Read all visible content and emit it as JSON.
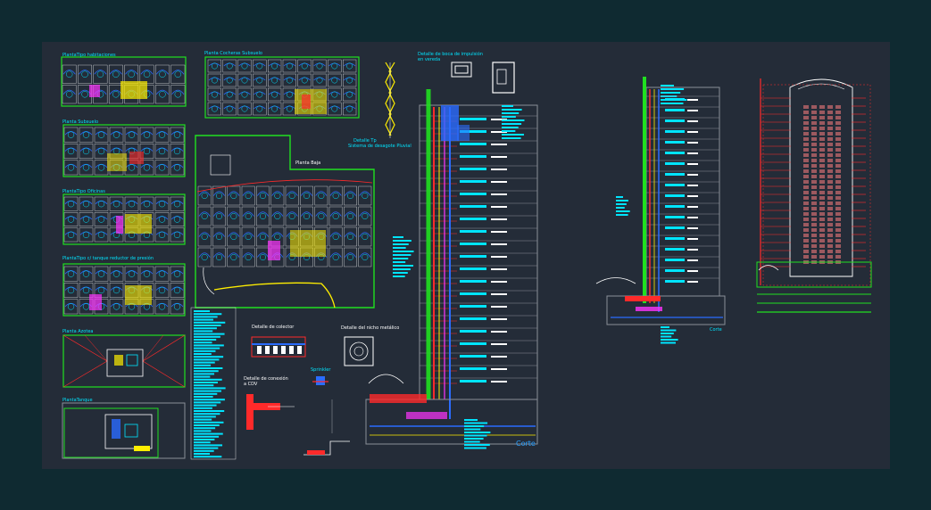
{
  "drawing": {
    "background": "#0f2a31",
    "sheet_color": "#242c38",
    "colors": {
      "green": "#20e020",
      "cyan": "#00e5ff",
      "blue": "#2a6cff",
      "red": "#ff2a2a",
      "magenta": "#ff33ff",
      "yellow": "#ffee00",
      "white": "#ffffff",
      "gray": "#8a8f98"
    }
  },
  "labels": {
    "planta_tipo_habitaciones": "PlantaTipo habitaciones",
    "planta_cocheras_subsuelo": "Planta Cocheras Subsuelo",
    "planta_subsuelo": "Planta Subsuelo",
    "planta_tipo_oficinas": "PlantaTipo Oficinas",
    "planta_tanque_reductor": "PlantaTipo c/ tanque reductor de presión",
    "planta_azotea": "Planta Azotea",
    "planta_tanque": "PlantaTanque",
    "planta_baja": "Planta Baja",
    "detalle_boca_impulsion": "Detalle de boca de impulsión",
    "en_vereda": "en vereda",
    "detalle_tp": "Detalle Tp",
    "sistema_desagote_pluvial": "Sistema de desagote Pluvial",
    "detalle_colector": "Detalle de colector",
    "detalle_nicho": "Detalle del nicho metálico",
    "sprinkler": "Sprinkler",
    "detalle_conexion": "Detalle de conexión",
    "a_cdv": "a CDV",
    "corte_1": "Corte",
    "corte_2": "Corte"
  }
}
